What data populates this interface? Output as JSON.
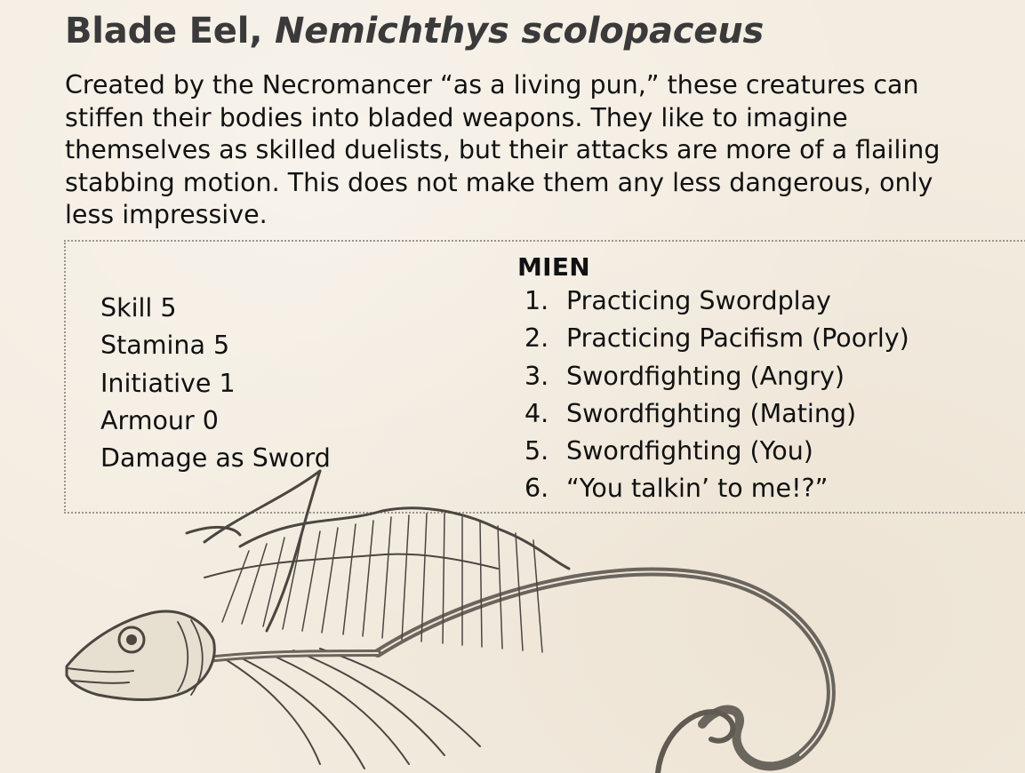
{
  "creature": {
    "name": "Blade Eel,",
    "scientific_name": "Nemichthys scolopaceus",
    "description": "Created by the Necromancer “as a living pun,” these creatures can stiffen their bodies into bladed weapons. They like to imagine themselves as skilled duelists, but their attacks are more of a flailing stabbing motion. This does not make them any less dangerous, only less impressive."
  },
  "stats": [
    "Skill 5",
    "Stamina 5",
    "Initiative 1",
    "Armour 0",
    "Damage as Sword"
  ],
  "mien": {
    "heading": "MIEN",
    "items": [
      {
        "num": "1.",
        "text": "Practicing Swordplay"
      },
      {
        "num": "2.",
        "text": "Practicing Pacifism (Poorly)"
      },
      {
        "num": "3.",
        "text": "Swordfighting (Angry)"
      },
      {
        "num": "4.",
        "text": "Swordfighting (Mating)"
      },
      {
        "num": "5.",
        "text": "Swordfighting (You)"
      },
      {
        "num": "6.",
        "text": "“You talkin’ to me!?”"
      }
    ]
  },
  "illustration": {
    "icon": "eel-engraving-illustration"
  },
  "colors": {
    "background": "#f3ece0",
    "title": "#3a3a3a",
    "text": "#111111",
    "border": "#9a958c"
  }
}
